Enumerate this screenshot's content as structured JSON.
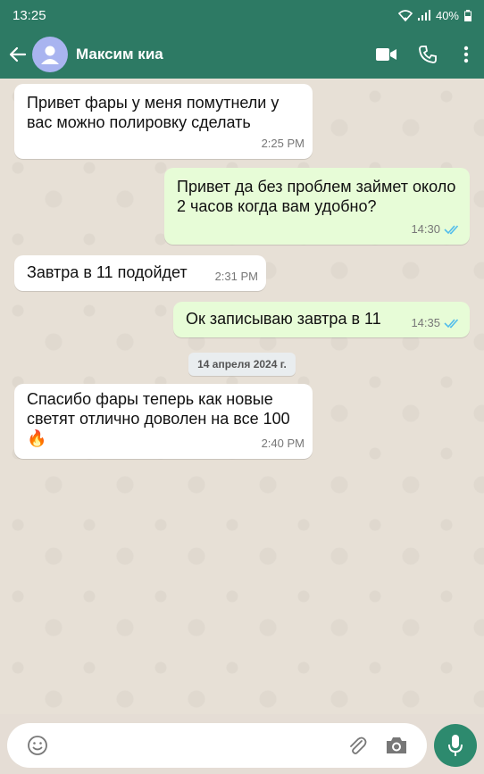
{
  "status_bar": {
    "time": "13:25",
    "battery": "40%",
    "icons": [
      "wifi-icon",
      "signal-icon",
      "battery-icon"
    ]
  },
  "header": {
    "contact_name": "Максим киа",
    "icons": [
      "back-arrow-icon",
      "avatar-icon",
      "video-call-icon",
      "phone-icon",
      "more-vert-icon"
    ]
  },
  "messages": [
    {
      "direction": "in",
      "text": "Привет фары у меня помутнели у вас можно полировку сделать",
      "time": "2:25 PM"
    },
    {
      "direction": "out",
      "text": "Привет да без проблем займет около 2 часов когда вам удобно?",
      "time": "14:30",
      "read": true
    },
    {
      "direction": "in",
      "text": "Завтра в 11 подойдет",
      "time": "2:31 PM"
    },
    {
      "direction": "out",
      "text": "Ок записываю завтра в 11",
      "time": "14:35",
      "read": true
    },
    {
      "direction": "in",
      "text": "Спасибо фары теперь как новые светят отлично доволен на все 100 🔥",
      "time": "2:40 PM"
    }
  ],
  "date_separator": "14 апреля 2024 г.",
  "composer": {
    "icons": [
      "emoji-icon",
      "attach-icon",
      "camera-icon",
      "mic-icon"
    ]
  },
  "colors": {
    "header": "#2d7a64",
    "outgoing_bubble": "#e7fcd7",
    "incoming_bubble": "#ffffff",
    "read_ticks": "#53bdeb",
    "mic_button": "#2d8a6e"
  }
}
